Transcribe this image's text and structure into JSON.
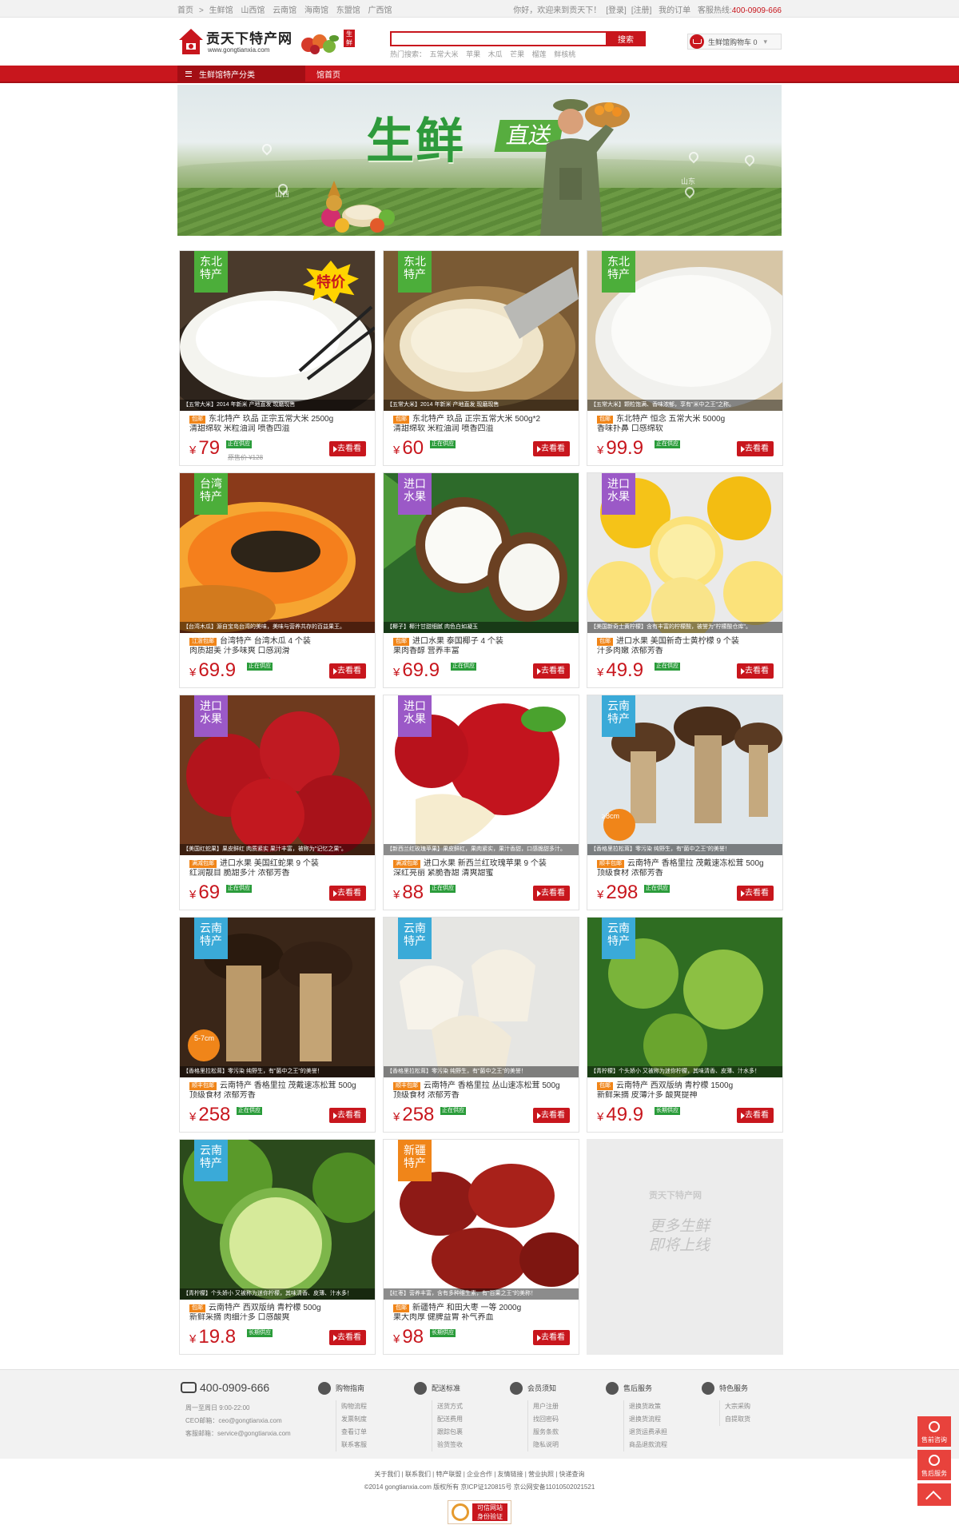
{
  "topbar": {
    "crumbs": [
      "首页",
      "生鲜馆",
      "山西馆",
      "云南馆",
      "海南馆",
      "东盟馆",
      "广西馆"
    ],
    "greeting": "你好，欢迎来到贡天下！",
    "login": "[登录]",
    "register": "[注册]",
    "orders": "我的订单",
    "hotline_label": "客服热线:",
    "hotline": "400-0909-666"
  },
  "logo": {
    "name": "贡天下特产网",
    "url": "www.gongtianxia.com",
    "tag": "生鲜"
  },
  "search": {
    "value": "",
    "button": "搜索",
    "hot_label": "热门搜索：",
    "hot_words": [
      "五常大米",
      "苹果",
      "木瓜",
      "芒果",
      "榴莲",
      "鲜核桃"
    ]
  },
  "cart": {
    "label": "生鲜馆购物车 0"
  },
  "nav": {
    "category": "生鲜馆特产分类",
    "home": "馆首页"
  },
  "banner": {
    "title": "生鲜",
    "subtitle": "直送",
    "place1": "山西",
    "place2": "山东"
  },
  "products": [
    {
      "badge": "东北\n特产",
      "badge_color": "#4cae3a",
      "caption": "【五常大米】2014 年新米 产地直发 现磨现售",
      "tag": "包邮",
      "title": "东北特产  玖品  正宗五常大米 2500g",
      "desc": "清甜绵软  米粒油润  喷香四溢",
      "price": "79",
      "status": "正在供应",
      "old": "原售价 ¥128",
      "special": "特价",
      "img": "rice1"
    },
    {
      "badge": "东北\n特产",
      "badge_color": "#4cae3a",
      "caption": "【五常大米】2014 年新米 产地直发 现磨现售",
      "tag": "包邮",
      "title": "东北特产  玖品  正宗五常大米 500g*2",
      "desc": "清甜绵软  米粒油润  喷香四溢",
      "price": "60",
      "status": "正在供应",
      "old": "",
      "special": "",
      "img": "rice2"
    },
    {
      "badge": "东北\n特产",
      "badge_color": "#4cae3a",
      "caption": "【五常大米】颗粒饱满、香味浓郁，享有\"米中之王\"之称。",
      "tag": "包邮",
      "title": "东北特产  恒念  五常大米 5000g",
      "desc": "香味扑鼻  口感绵软",
      "price": "99.9",
      "status": "正在供应",
      "old": "",
      "special": "",
      "img": "rice3"
    },
    {
      "badge": "台湾\n特产",
      "badge_color": "#4cae3a",
      "caption": "【台湾木瓜】源自宝岛台湾的美味，美味与营养共存的百益果王。",
      "tag": "江浙包邮",
      "title": "台湾特产  台湾木瓜  4 个装",
      "desc": "肉质甜美  汁多味爽  口感润滑",
      "price": "69.9",
      "status": "正在供应",
      "old": "",
      "special": "",
      "img": "papaya"
    },
    {
      "badge": "进口\n水果",
      "badge_color": "#9b59c7",
      "caption": "【椰子】椰汁甘甜细腻 肉色白如凝玉",
      "tag": "包邮",
      "title": "进口水果  泰国椰子  4 个装",
      "desc": "果肉香醇  营养丰富",
      "price": "69.9",
      "status": "正在供应",
      "old": "",
      "special": "",
      "img": "coconut"
    },
    {
      "badge": "进口\n水果",
      "badge_color": "#9b59c7",
      "caption": "【美国新奇士黄柠檬】含有丰富的柠檬酸，被誉为\"柠檬酸仓库\"。",
      "tag": "包邮",
      "title": "进口水果  美国新奇士黄柠檬  9 个装",
      "desc": "汁多肉嫩  浓郁芳香",
      "price": "49.9",
      "status": "正在供应",
      "old": "",
      "special": "",
      "img": "lemon"
    },
    {
      "badge": "进口\n水果",
      "badge_color": "#9b59c7",
      "caption": "【美国红蛇果】果皮鲜红 肉质紧实 果汁丰富，被称为\"记忆之果\"。",
      "tag": "满减包邮",
      "title": "进口水果  美国红蛇果  9 个装",
      "desc": "红润靓目  脆甜多汁  浓郁芳香",
      "price": "69",
      "status": "正在供应",
      "old": "",
      "special": "",
      "img": "apple1"
    },
    {
      "badge": "进口\n水果",
      "badge_color": "#9b59c7",
      "caption": "【新西兰红玫瑰苹果】果皮鲜红，果肉紧实，果汁香甜，口感脆甜多汁。",
      "tag": "满减包邮",
      "title": "进口水果  新西兰红玫瑰苹果  9 个装",
      "desc": "深红亮丽  紧脆香甜  清爽甜蜜",
      "price": "88",
      "status": "正在供应",
      "old": "",
      "special": "",
      "img": "apple2"
    },
    {
      "badge": "云南\n特产",
      "badge_color": "#3aaad8",
      "caption": "【香格里拉松茸】零污染 纯野生，有\"菌中之王\"的美誉！",
      "tag": "顺丰包邮",
      "title": "云南特产  香格里拉  茂戴速冻松茸 500g",
      "desc": "顶级食材  浓郁芳香",
      "price": "298",
      "status": "正在供应",
      "old": "",
      "special": "",
      "img": "mush1",
      "size": "≥8cm"
    },
    {
      "badge": "云南\n特产",
      "badge_color": "#3aaad8",
      "caption": "【香格里拉松茸】零污染 纯野生，有\"菌中之王\"的美誉！",
      "tag": "顺丰包邮",
      "title": "云南特产  香格里拉  茂戴速冻松茸 500g",
      "desc": "顶级食材  浓郁芳香",
      "price": "258",
      "status": "正在供应",
      "old": "",
      "special": "",
      "img": "mush2",
      "size": "5-7cm"
    },
    {
      "badge": "云南\n特产",
      "badge_color": "#3aaad8",
      "caption": "【香格里拉松茸】零污染 纯野生，有\"菌中之王\"的美誉！",
      "tag": "顺丰包邮",
      "title": "云南特产  香格里拉  丛山速冻松茸 500g",
      "desc": "顶级食材  浓郁芳香",
      "price": "258",
      "status": "正在供应",
      "old": "",
      "special": "",
      "img": "mush3"
    },
    {
      "badge": "云南\n特产",
      "badge_color": "#3aaad8",
      "caption": "【青柠檬】个头娇小 又被称为迷你柠檬，其味清香、皮薄、汁水多！",
      "tag": "包邮",
      "title": "云南特产  西双版纳  青柠檬 1500g",
      "desc": "新鲜采摘  皮薄汁多  酸爽提神",
      "price": "49.9",
      "status": "长期供应",
      "old": "",
      "special": "",
      "img": "lime1"
    },
    {
      "badge": "云南\n特产",
      "badge_color": "#3aaad8",
      "caption": "【青柠檬】个头娇小 又被称为迷你柠檬，其味清香、皮薄、汁水多！",
      "tag": "包邮",
      "title": "云南特产  西双版纳  青柠檬 500g",
      "desc": "新鲜采摘  肉细汁多  口感酸爽",
      "price": "19.8",
      "status": "长期供应",
      "old": "",
      "special": "",
      "img": "lime2"
    },
    {
      "badge": "新疆\n特产",
      "badge_color": "#f08519",
      "caption": "【红枣】营养丰富，含有多种维生素，有\"百果之王\"的美称！",
      "tag": "包邮",
      "title": "新疆特产  和田大枣  一等 2000g",
      "desc": "果大肉厚  健脾益胃  补气养血",
      "price": "98",
      "status": "长期供应",
      "old": "",
      "special": "",
      "img": "dates"
    }
  ],
  "more": {
    "logo": "贡天下特产网",
    "text1": "更多生鲜",
    "text2": "即将上线"
  },
  "footer": {
    "phone": "400-0909-666",
    "hours": "周一至周日 9:00-22:00",
    "ceo": "CEO邮箱：ceo@gongtianxia.com",
    "service": "客服邮箱：service@gongtianxia.com",
    "cols": [
      {
        "title": "购物指南",
        "items": [
          "购物流程",
          "发票制度",
          "查看订单",
          "联系客服"
        ]
      },
      {
        "title": "配送标准",
        "items": [
          "送货方式",
          "配送费用",
          "跟踪包裹",
          "验货签收"
        ]
      },
      {
        "title": "会员须知",
        "items": [
          "用户注册",
          "找回密码",
          "服务条款",
          "隐私说明"
        ]
      },
      {
        "title": "售后服务",
        "items": [
          "退换货政策",
          "退换货流程",
          "退货运费承担",
          "商品退款流程"
        ]
      },
      {
        "title": "特色服务",
        "items": [
          "大宗采购",
          "自提取货"
        ]
      }
    ],
    "links": "关于我们 | 联系我们 | 特产联盟 | 企业合作 | 友情链接 | 营业执照 | 快递查询",
    "copyright": "©2014 gongtianxia.com 版权所有  京ICP证120815号  京公网安备11010502021521",
    "trust": "可信网站",
    "trust_sub": "身份验证"
  },
  "float": {
    "consult": "售前咨询",
    "after": "售后服务"
  }
}
